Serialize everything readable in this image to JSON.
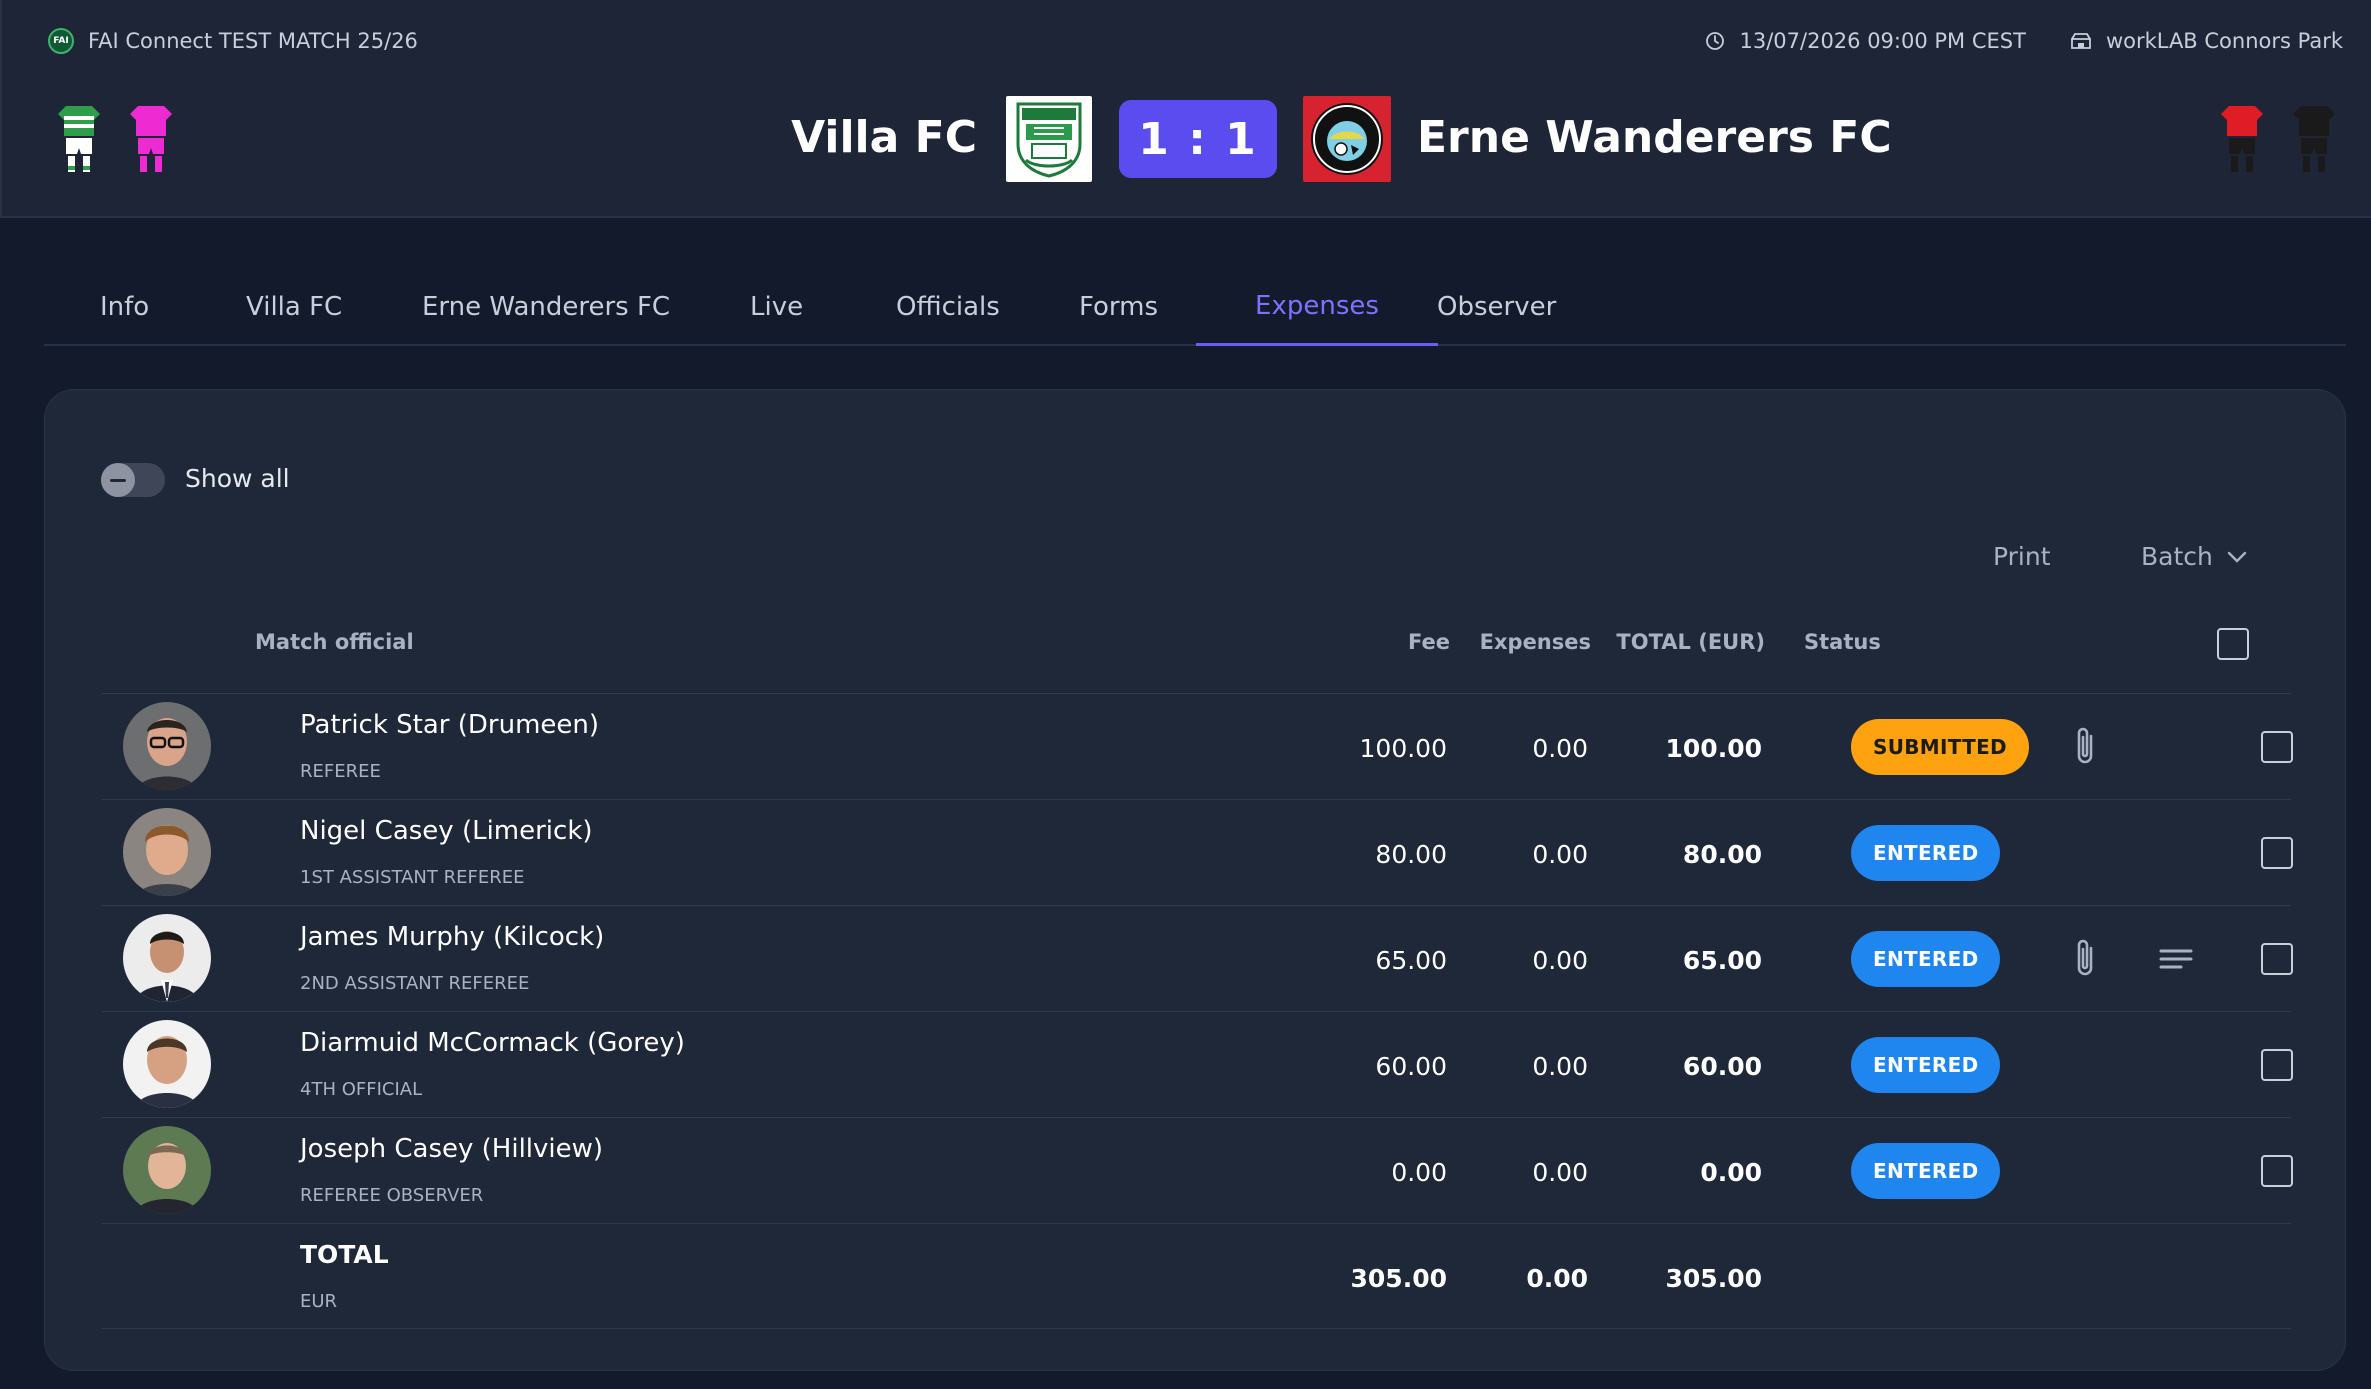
{
  "match": {
    "competition": "FAI Connect TEST MATCH 25/26",
    "datetime": "13/07/2026 09:00 PM CEST",
    "venue": "workLAB Connors Park",
    "home_team": "Villa FC",
    "away_team": "Erne Wanderers FC",
    "score": "1 : 1"
  },
  "tabs": [
    {
      "label": "Info"
    },
    {
      "label": "Villa FC"
    },
    {
      "label": "Erne Wanderers FC"
    },
    {
      "label": "Live"
    },
    {
      "label": "Officials"
    },
    {
      "label": "Forms"
    },
    {
      "label": "Expenses"
    },
    {
      "label": "Observer"
    }
  ],
  "active_tab": "Expenses",
  "toolbar": {
    "show_all_label": "Show all",
    "print_label": "Print",
    "batch_label": "Batch"
  },
  "table": {
    "headers": {
      "official": "Match official",
      "fee": "Fee",
      "expenses": "Expenses",
      "total": "TOTAL (EUR)",
      "status": "Status"
    },
    "rows": [
      {
        "name": "Patrick Star (Drumeen)",
        "role": "REFEREE",
        "fee": "100.00",
        "expenses": "0.00",
        "total": "100.00",
        "status": "SUBMITTED",
        "attachment": true,
        "notes": false
      },
      {
        "name": "Nigel Casey (Limerick)",
        "role": "1ST ASSISTANT REFEREE",
        "fee": "80.00",
        "expenses": "0.00",
        "total": "80.00",
        "status": "ENTERED",
        "attachment": false,
        "notes": false
      },
      {
        "name": "James Murphy (Kilcock)",
        "role": "2ND ASSISTANT REFEREE",
        "fee": "65.00",
        "expenses": "0.00",
        "total": "65.00",
        "status": "ENTERED",
        "attachment": true,
        "notes": true
      },
      {
        "name": "Diarmuid McCormack (Gorey)",
        "role": "4TH OFFICIAL",
        "fee": "60.00",
        "expenses": "0.00",
        "total": "60.00",
        "status": "ENTERED",
        "attachment": false,
        "notes": false
      },
      {
        "name": "Joseph Casey (Hillview)",
        "role": "REFEREE OBSERVER",
        "fee": "0.00",
        "expenses": "0.00",
        "total": "0.00",
        "status": "ENTERED",
        "attachment": false,
        "notes": false
      }
    ],
    "totals": {
      "label": "TOTAL",
      "currency": "EUR",
      "fee": "305.00",
      "expenses": "0.00",
      "total": "305.00"
    }
  },
  "colors": {
    "accent": "#5b4cf0",
    "submitted": "#ffa20f",
    "entered": "#1f86f0",
    "background": "#121a2b"
  }
}
